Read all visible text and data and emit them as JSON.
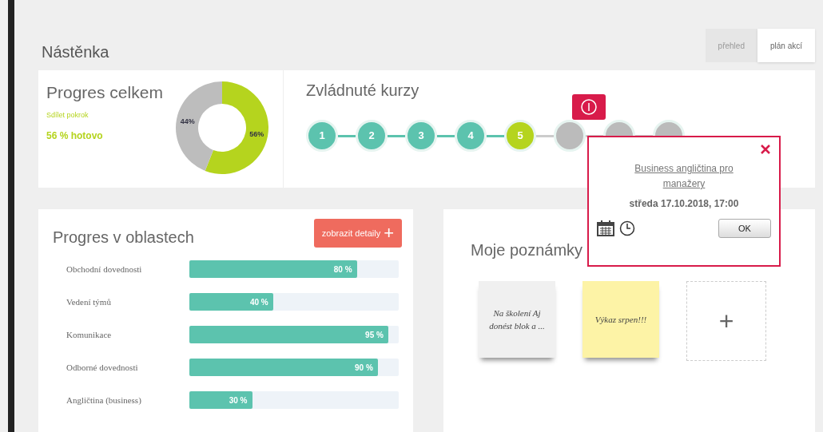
{
  "page_title": "Nástěnka",
  "tabs": [
    {
      "label": "přehled",
      "selected": false
    },
    {
      "label": "plán akcí",
      "selected": true
    }
  ],
  "overall": {
    "title": "Progres celkem",
    "link": "Sdílet pokrok",
    "summary": "56 % hotovo",
    "chart_data": {
      "type": "donut",
      "values": [
        56,
        44
      ],
      "value_labels": [
        "56%",
        "44%"
      ]
    }
  },
  "courses": {
    "title": "Zvládnuté kurzy",
    "steps": [
      {
        "label": "1",
        "completed": true,
        "selected": false
      },
      {
        "label": "2",
        "completed": true,
        "selected": false
      },
      {
        "label": "3",
        "completed": true,
        "selected": false
      },
      {
        "label": "4",
        "completed": true,
        "selected": false
      },
      {
        "label": "5",
        "completed": false,
        "selected": true
      },
      {
        "completed": false,
        "selected": false
      },
      {
        "completed": false,
        "selected": false
      },
      {
        "completed": false,
        "selected": false
      }
    ]
  },
  "popup": {
    "title": "Business angličtina pro manažery",
    "date": "středa 17.10.2018, 17:00",
    "ok": "OK"
  },
  "areas": {
    "title": "Progres v oblastech",
    "button": "zobrazit detaily",
    "button_icon": "+",
    "rows": [
      {
        "name": "Obchodní dovednosti",
        "reading": "80 %",
        "level": 0.8
      },
      {
        "name": "Vedení týmů",
        "reading": "40 %",
        "level": 0.4
      },
      {
        "name": "Komunikace",
        "reading": "95 %",
        "level": 0.95
      },
      {
        "name": "Odborné dovednosti",
        "reading": "90 %",
        "level": 0.9
      },
      {
        "name": "Angličtina (business)",
        "reading": "30 %",
        "level": 0.3
      }
    ]
  },
  "notes": {
    "title": "Moje poznámky",
    "items": [
      {
        "kind": "note",
        "text": "Na školení Aj donést blok a ...",
        "color": "#f0f0f0"
      },
      {
        "kind": "note",
        "text": "Výkaz srpen!!!",
        "color": "#fdf3a6"
      },
      {
        "kind": "add",
        "text": "+"
      }
    ]
  }
}
